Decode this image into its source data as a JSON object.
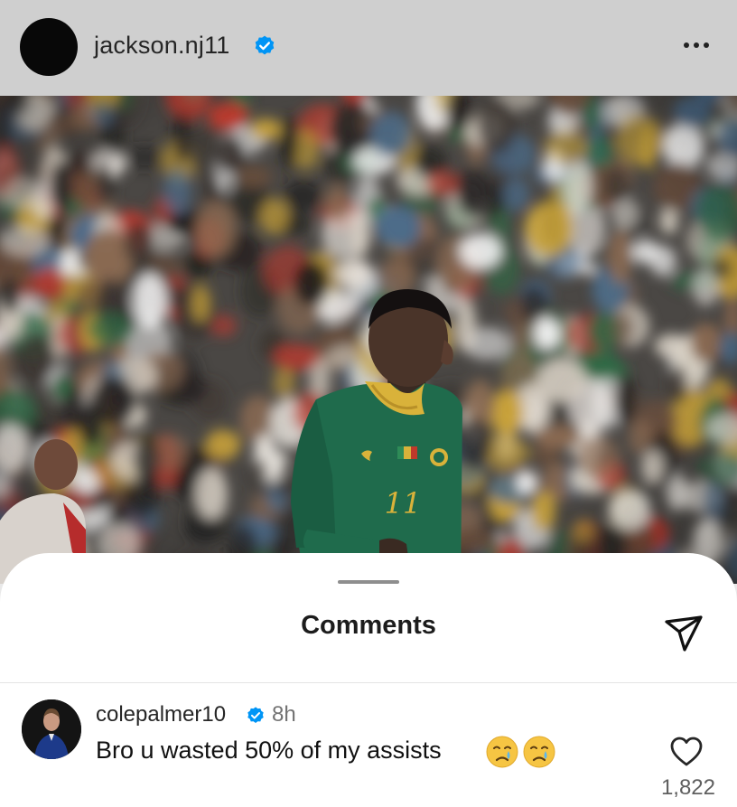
{
  "post": {
    "username": "jackson.nj11",
    "verified": true,
    "more_icon": "more-horizontal-icon",
    "photo": {
      "description_icon": "photo",
      "jersey_number": "11"
    }
  },
  "comments_sheet": {
    "title": "Comments",
    "share_icon": "paper-plane-icon",
    "comments": [
      {
        "username": "colepalmer10",
        "verified": true,
        "time": "8h",
        "text": "Bro u wasted 50% of my assists",
        "emojis": [
          "crying-face",
          "crying-face"
        ],
        "like_icon": "heart-outline-icon",
        "likes": "1,822"
      }
    ]
  },
  "colors": {
    "verified_blue": "#0095f6",
    "jersey_green": "#1f6b4c",
    "jersey_collar": "#d9b23a",
    "sheet_bg": "#ffffff"
  }
}
